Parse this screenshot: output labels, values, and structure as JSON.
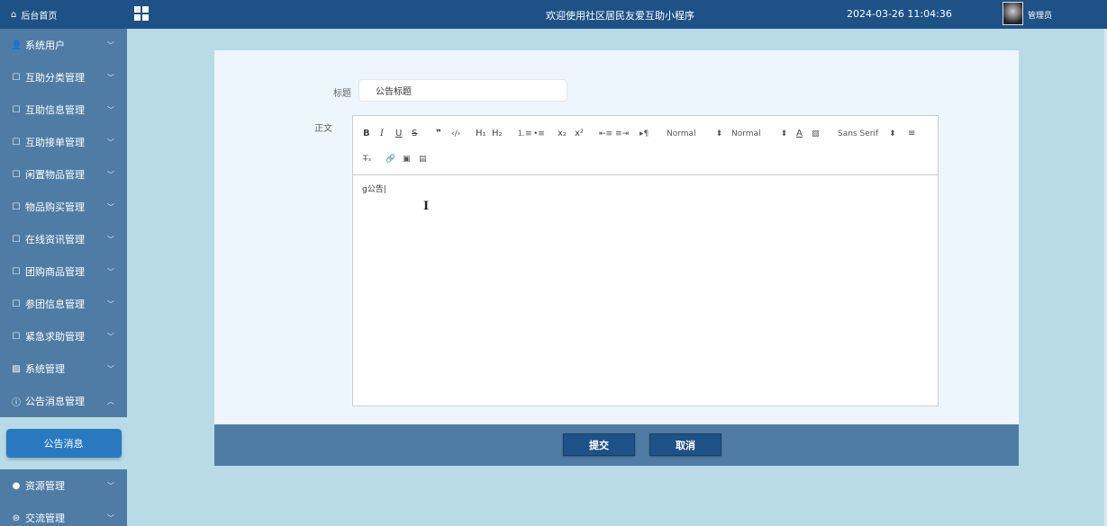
{
  "sidebar": {
    "home": "后台首页",
    "items": [
      {
        "icon": "user-icon",
        "label": "系统用户"
      },
      {
        "icon": "external-box-icon",
        "label": "互助分类管理"
      },
      {
        "icon": "external-box-icon",
        "label": "互助信息管理"
      },
      {
        "icon": "external-box-icon",
        "label": "互助接单管理"
      },
      {
        "icon": "external-box-icon",
        "label": "闲置物品管理"
      },
      {
        "icon": "external-box-icon",
        "label": "物品购买管理"
      },
      {
        "icon": "external-box-icon",
        "label": "在线资讯管理"
      },
      {
        "icon": "external-box-icon",
        "label": "团购商品管理"
      },
      {
        "icon": "external-box-icon",
        "label": "参团信息管理"
      },
      {
        "icon": "external-box-icon",
        "label": "紧急求助管理"
      },
      {
        "icon": "picture-icon",
        "label": "系统管理"
      },
      {
        "icon": "info-circle-icon",
        "label": "公告消息管理"
      }
    ],
    "active_sub": "公告消息",
    "bottom_items": [
      {
        "icon": "bulb-icon",
        "label": "资源管理"
      },
      {
        "icon": "chat-icon",
        "label": "交流管理"
      }
    ]
  },
  "header": {
    "title": "欢迎使用社区居民友爱互助小程序",
    "datetime": "2024-03-26 11:04:36",
    "user": "管理员"
  },
  "form": {
    "title_label": "标题",
    "title_value": "公告标题",
    "body_label": "正文",
    "body_content": "g公告|"
  },
  "toolbar": {
    "bold": "B",
    "italic": "I",
    "underline": "U",
    "strike": "S",
    "quote": "❞",
    "code": "‹/›",
    "h1": "H₁",
    "h2": "H₂",
    "ordered": "⒈≡",
    "bullet": "•≡",
    "sub": "x₂",
    "sup": "x²",
    "outdent": "⇤≡",
    "indent": "≡⇥",
    "direction": "▸¶",
    "size_value": "Normal",
    "header_value": "Normal",
    "color": "A",
    "background": "▧",
    "font_value": "Sans Serif",
    "align": "≡",
    "clean": "T̶ₓ",
    "link": "🔗",
    "image": "▣",
    "video": "▤",
    "select_arrow": "⬍"
  },
  "actions": {
    "submit": "提交",
    "cancel": "取消"
  }
}
